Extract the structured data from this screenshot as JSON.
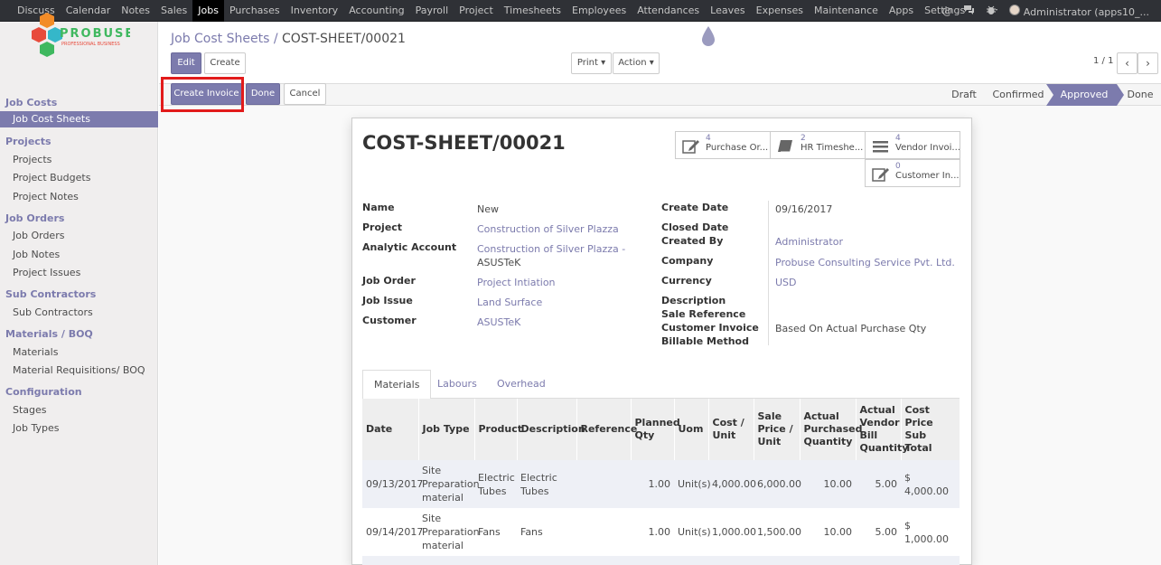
{
  "topmenu": [
    "Discuss",
    "Calendar",
    "Notes",
    "Sales",
    "Jobs",
    "Purchases",
    "Inventory",
    "Accounting",
    "Payroll",
    "Project",
    "Timesheets",
    "Employees",
    "Attendances",
    "Leaves",
    "Expenses",
    "Maintenance",
    "Apps",
    "Settings"
  ],
  "user": "Administrator (apps10_...",
  "logo": {
    "name": "PROBUSE",
    "tagline": "PROFESSIONAL BUSINESS"
  },
  "sidebar": {
    "s1": "Job Costs",
    "i1": "Job Cost Sheets",
    "s2": "Projects",
    "i2": "Projects",
    "i3": "Project Budgets",
    "i4": "Project Notes",
    "s3": "Job Orders",
    "i5": "Job Orders",
    "i6": "Job Notes",
    "i7": "Project Issues",
    "s4": "Sub Contractors",
    "i8": "Sub Contractors",
    "s5": "Materials / BOQ",
    "i9": "Materials",
    "i10": "Material Requisitions/ BOQ",
    "s6": "Configuration",
    "i11": "Stages",
    "i12": "Job Types"
  },
  "breadcrumb": {
    "parent": "Job Cost Sheets /",
    "current": "COST-SHEET/00021"
  },
  "buttons": {
    "edit": "Edit",
    "create": "Create",
    "print": "Print ▾",
    "action": "Action ▾",
    "create_invoice": "Create Invoice",
    "done": "Done",
    "cancel": "Cancel"
  },
  "pager": "1 / 1",
  "stages": [
    "Draft",
    "Confirmed",
    "Approved",
    "Done"
  ],
  "form": {
    "title": "COST-SHEET/00021",
    "smart": [
      {
        "count": "4",
        "label": "Purchase Or..."
      },
      {
        "count": "2",
        "label": "HR Timeshe..."
      },
      {
        "count": "4",
        "label": "Vendor Invoi..."
      },
      {
        "count": "0",
        "label": "Customer In..."
      }
    ],
    "left": {
      "name_l": "Name",
      "name_v": "New",
      "project_l": "Project",
      "project_v": "Construction of Silver Plazza",
      "analytic_l": "Analytic Account",
      "analytic_v1": "Construction of Silver Plazza -",
      "analytic_v2": "ASUSTeK",
      "order_l": "Job Order",
      "order_v": "Project Intiation",
      "issue_l": "Job Issue",
      "issue_v": "Land Surface",
      "customer_l": "Customer",
      "customer_v": "ASUSTeK"
    },
    "right": {
      "cdate_l": "Create Date",
      "cdate_v": "09/16/2017",
      "closed_l": "Closed Date",
      "by_l": "Created By",
      "by_v": "Administrator",
      "company_l": "Company",
      "company_v": "Probuse Consulting Service Pvt. Ltd.",
      "currency_l": "Currency",
      "currency_v": "USD",
      "desc_l": "Description",
      "saleref_l": "Sale Reference",
      "custinv_l": "Customer Invoice",
      "billable_l": "Billable Method",
      "billable_v": "Based On Actual Purchase Qty"
    }
  },
  "tabs": [
    "Materials",
    "Labours",
    "Overhead"
  ],
  "table": {
    "headers": [
      "Date",
      "Job Type",
      "Product",
      "Description",
      "Reference",
      "Planned Qty",
      "Uom",
      "Cost / Unit",
      "Sale Price / Unit",
      "Actual Purchased Quantity",
      "Actual Vendor Bill Quantity",
      "Cost Price Sub Total"
    ],
    "rows": [
      [
        "09/13/2017",
        "Site Preparation material",
        "Electric Tubes",
        "Electric Tubes",
        "",
        "1.00",
        "Unit(s)",
        "4,000.00",
        "6,000.00",
        "10.00",
        "5.00",
        "$ 4,000.00"
      ],
      [
        "09/14/2017",
        "Site Preparation material",
        "Fans",
        "Fans",
        "",
        "1.00",
        "Unit(s)",
        "1,000.00",
        "1,500.00",
        "10.00",
        "5.00",
        "$ 1,000.00"
      ]
    ]
  },
  "colors": {
    "accent": "#7c7bad",
    "topbar": "#2f3136",
    "highlight": "#e21b1b"
  }
}
